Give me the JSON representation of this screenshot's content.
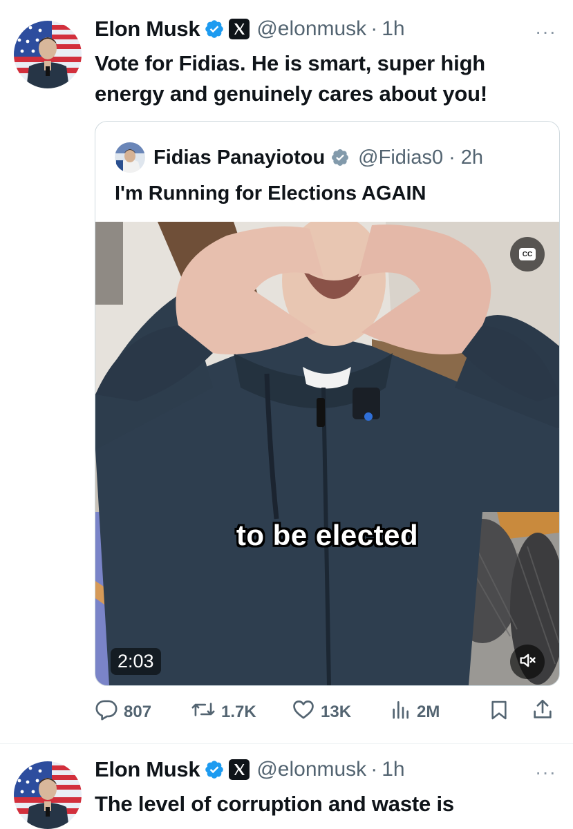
{
  "tweet1": {
    "author": "Elon Musk",
    "handle": "@elonmusk",
    "separator": "·",
    "time": "1h",
    "text_line1": "Vote for Fidias. He is smart, super high",
    "text_line2": "energy and genuinely cares about you!",
    "more": "···"
  },
  "quote": {
    "author": "Fidias Panayiotou",
    "handle": "@Fidias0",
    "separator": "·",
    "time": "2h",
    "text": "I'm Running for Elections AGAIN",
    "video": {
      "caption": "to be elected",
      "duration": "2:03",
      "cc_label": "CC"
    }
  },
  "actions": {
    "replies": "807",
    "reposts": "1.7K",
    "likes": "13K",
    "views": "2M"
  },
  "tweet2": {
    "author": "Elon Musk",
    "handle": "@elonmusk",
    "separator": "·",
    "time": "1h",
    "text_line1": "The level of corruption and waste is",
    "text_line2": "",
    "more": "···"
  },
  "colors": {
    "verified": "#1d9bf0",
    "quote_verified": "#829aab",
    "muted": "#536471",
    "border": "#cfd9de"
  },
  "icons": [
    "verified-badge-icon",
    "x-logo-icon",
    "more-icon",
    "cc-icon",
    "mute-icon",
    "reply-icon",
    "repost-icon",
    "like-icon",
    "views-icon",
    "bookmark-icon",
    "share-icon"
  ]
}
